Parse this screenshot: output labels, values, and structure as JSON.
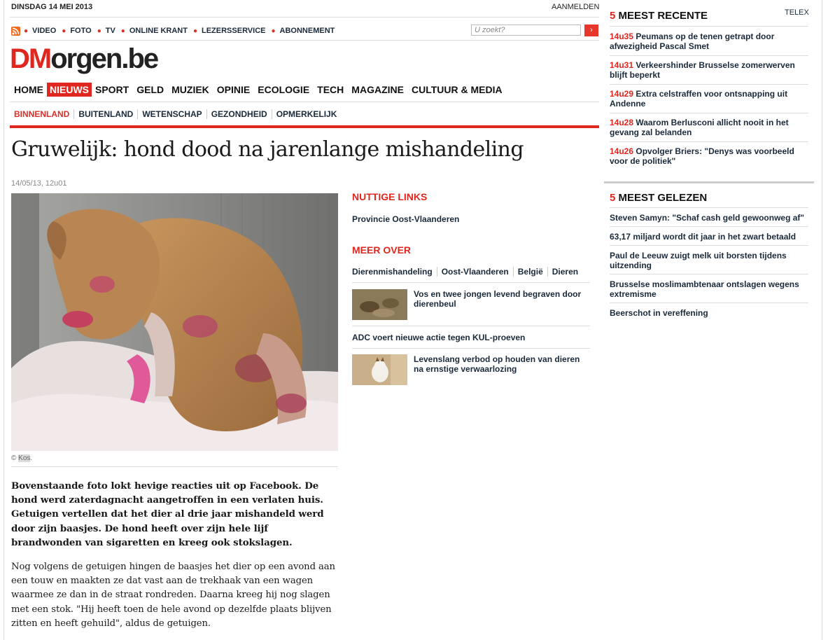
{
  "topbar": {
    "date": "DINSDAG 14 MEI 2013",
    "login": "AANMELDEN"
  },
  "utilnav": [
    "VIDEO",
    "FOTO",
    "TV",
    "ONLINE KRANT",
    "LEZERSSERVICE",
    "ABONNEMENT"
  ],
  "search": {
    "placeholder": "U zoekt?",
    "button": "›"
  },
  "logo": {
    "dm": "DM",
    "rest": "orgen.be"
  },
  "mainnav": [
    "HOME",
    "NIEUWS",
    "SPORT",
    "GELD",
    "MUZIEK",
    "OPINIE",
    "ECOLOGIE",
    "TECH",
    "MAGAZINE",
    "CULTUUR & MEDIA"
  ],
  "subnav": [
    "BINNENLAND",
    "BUITENLAND",
    "WETENSCHAP",
    "GEZONDHEID",
    "OPMERKELIJK"
  ],
  "article": {
    "headline": "Gruwelijk: hond dood na jarenlange mishandeling",
    "timestamp": "14/05/13, 12u01",
    "credit_prefix": "© ",
    "credit": "Kos",
    "credit_suffix": ".",
    "lead": "Bovenstaande foto lokt hevige reacties uit op Facebook. De hond werd zaterdagnacht aangetroffen in een verlaten huis. Getuigen vertellen dat het dier al drie jaar mishandeld werd door zijn baasjes. De hond heeft over zijn hele lijf brandwonden van sigaretten en kreeg ook stokslagen.",
    "body": "Nog volgens de getuigen hingen de baasjes het dier op een avond aan een touw en maakten ze dat vast aan de trekhaak van een wagen waarmee ze dan in de straat rondreden. Daarna kreeg hij nog slagen met een stok. \"Hij heeft toen de hele avond op dezelfde plaats blijven zitten en heeft gehuild\", aldus de getuigen."
  },
  "sidebar": {
    "nuttige_heading": "NUTTIGE LINKS",
    "nuttige_link": "Provincie Oost-Vlaanderen",
    "meer_heading": "MEER OVER",
    "tags": [
      "Dierenmishandeling",
      "Oost-Vlaanderen",
      "België",
      "Dieren"
    ],
    "related": [
      "Vos en twee jongen levend begraven door dierenbeul",
      "ADC voert nieuwe actie tegen KUL-proeven",
      "Levenslang verbod op houden van dieren na ernstige verwaarlozing"
    ]
  },
  "recent": {
    "count": "5",
    "title": " MEEST RECENTE",
    "telex": "TELEX",
    "items": [
      {
        "time": "14u35",
        "text": " Peumans op de tenen getrapt door afwezigheid Pascal Smet"
      },
      {
        "time": "14u31",
        "text": " Verkeershinder Brusselse zomerwerven blijft beperkt"
      },
      {
        "time": "14u29",
        "text": " Extra celstraffen voor ontsnapping uit Andenne"
      },
      {
        "time": "14u28",
        "text": " Waarom Berlusconi allicht nooit in het gevang zal belanden"
      },
      {
        "time": "14u26",
        "text": " Opvolger Briers: \"Denys was voorbeeld voor de politiek\""
      }
    ]
  },
  "gelezen": {
    "count": "5",
    "title": " MEEST GELEZEN",
    "items": [
      "Steven Samyn: \"Schaf cash geld gewoonweg af\"",
      "63,17 miljard wordt dit jaar in het zwart betaald",
      "Paul de Leeuw zuigt melk uit borsten tijdens uitzending",
      "Brusselse moslimambtenaar ontslagen wegens extremisme",
      "Beerschot in vereffening"
    ]
  }
}
